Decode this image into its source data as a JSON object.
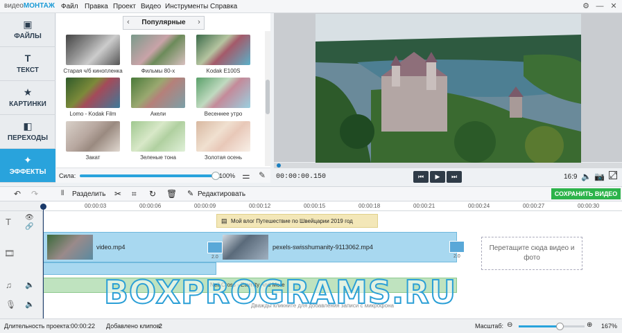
{
  "app": {
    "logo_a": "видео",
    "logo_b": "МОНТАЖ"
  },
  "menu": [
    "Файл",
    "Правка",
    "Проект",
    "Видео",
    "Инструменты",
    "Справка"
  ],
  "sidebar": [
    {
      "label": "ФАЙЛЫ",
      "icon": "image-icon"
    },
    {
      "label": "ТЕКСТ",
      "icon": "text-icon"
    },
    {
      "label": "КАРТИНКИ",
      "icon": "star-icon"
    },
    {
      "label": "ПЕРЕХОДЫ",
      "icon": "transitions-icon"
    },
    {
      "label": "ЭФФЕКТЫ",
      "icon": "effects-wand-icon"
    }
  ],
  "gallery": {
    "category": "Популярные",
    "items": [
      {
        "label": "Старая ч/б кинопленка"
      },
      {
        "label": "Фильмы 80-х"
      },
      {
        "label": "Kodak E100S"
      },
      {
        "label": "Lomo - Kodak Film"
      },
      {
        "label": "Акели"
      },
      {
        "label": "Весеннее утро"
      },
      {
        "label": "Закат"
      },
      {
        "label": "Зеленые тона"
      },
      {
        "label": "Золотая осень"
      }
    ],
    "strength_label": "Сила:",
    "strength_value": "100%",
    "strength_fraction": 1.0
  },
  "player": {
    "time": "00:00:00.150",
    "aspect": "16:9"
  },
  "toolbar": {
    "split": "Разделить",
    "edit": "Редактировать",
    "save": "СОХРАНИТЬ ВИДЕО"
  },
  "ruler": [
    "00:00:03",
    "00:00:06",
    "00:00:09",
    "00:00:12",
    "00:00:15",
    "00:00:18",
    "00:00:21",
    "00:00:24",
    "00:00:27",
    "00:00:30"
  ],
  "timeline": {
    "title_clip": "Мой влог  Путешествие по Швейцарии  2019 год",
    "clip1": "video.mp4",
    "clip2": "pexels-swisshumanity-9113062.mp4",
    "t1": "2.0",
    "t2": "2.0",
    "drop_hint": "Перетащите сюда видео и фото",
    "audio": "Neil Cross - Eternity And More",
    "voice_hint": "Дважды кликните для добавления записи с микрофона"
  },
  "watermark": "BOXPROGRAMS.RU",
  "status": {
    "duration_label": "Длительность проекта:",
    "duration": "00:00:22",
    "clips_label": "Добавлено клипов:",
    "clips": "2",
    "zoom_label": "Масштаб:",
    "zoom": "167%",
    "zoom_fraction": 0.62
  }
}
